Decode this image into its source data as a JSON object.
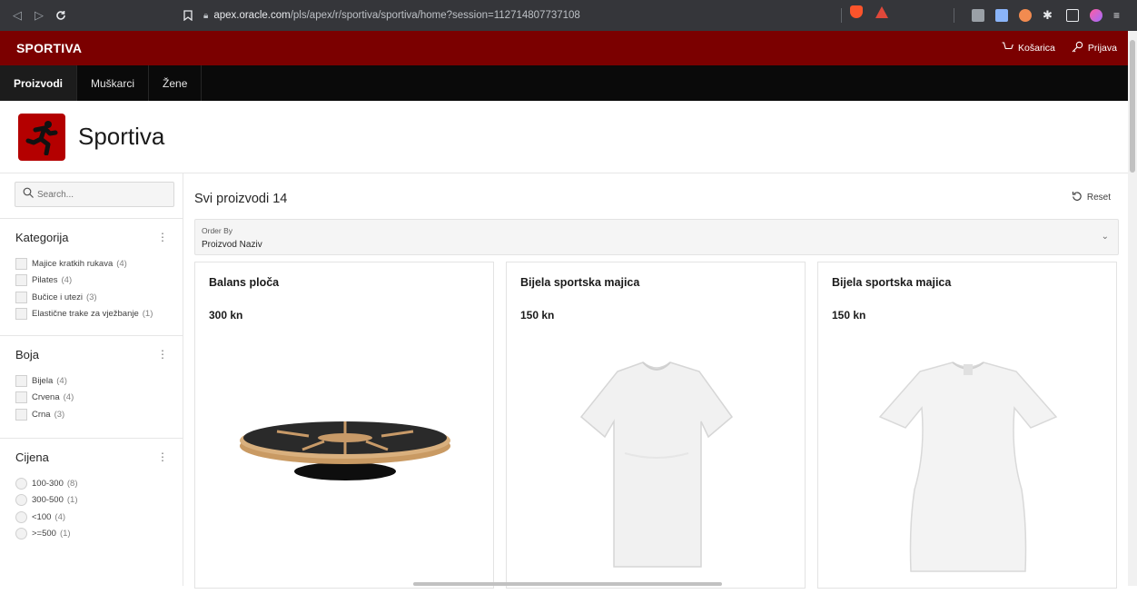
{
  "browser": {
    "url_host": "apex.oracle.com",
    "url_path": "/pls/apex/r/sportiva/sportiva/home?session=112714807737108"
  },
  "header": {
    "brand": "SPORTIVA",
    "cart_label": "Košarica",
    "login_label": "Prijava"
  },
  "nav": {
    "items": [
      {
        "label": "Proizvodi",
        "current": true
      },
      {
        "label": "Muškarci",
        "current": false
      },
      {
        "label": "Žene",
        "current": false
      }
    ]
  },
  "hero": {
    "title": "Sportiva"
  },
  "sidebar": {
    "search_placeholder": "Search...",
    "facets": [
      {
        "title": "Kategorija",
        "type": "checkbox",
        "options": [
          {
            "label": "Majice kratkih rukava",
            "count": "(4)"
          },
          {
            "label": "Pilates",
            "count": "(4)"
          },
          {
            "label": "Bučice i utezi",
            "count": "(3)"
          },
          {
            "label": "Elastične trake za vježbanje",
            "count": "(1)"
          }
        ]
      },
      {
        "title": "Boja",
        "type": "checkbox",
        "options": [
          {
            "label": "Bijela",
            "count": "(4)"
          },
          {
            "label": "Crvena",
            "count": "(4)"
          },
          {
            "label": "Crna",
            "count": "(3)"
          }
        ]
      },
      {
        "title": "Cijena",
        "type": "radio",
        "options": [
          {
            "label": "100-300",
            "count": "(8)"
          },
          {
            "label": "300-500",
            "count": "(1)"
          },
          {
            "label": "<100",
            "count": "(4)"
          },
          {
            "label": ">=500",
            "count": "(1)"
          }
        ]
      }
    ]
  },
  "results": {
    "title": "Svi proizvodi 14",
    "reset_label": "Reset",
    "order_by_label": "Order By",
    "order_by_value": "Proizvod Naziv"
  },
  "products": [
    {
      "name": "Balans ploča",
      "price": "300 kn",
      "image": "balance-board"
    },
    {
      "name": "Bijela sportska majica",
      "price": "150 kn",
      "image": "white-tshirt-men"
    },
    {
      "name": "Bijela sportska majica",
      "price": "150 kn",
      "image": "white-tshirt-women"
    }
  ],
  "colors": {
    "header_bg": "#7b0000",
    "menu_bg": "#0a0a0a",
    "logo_bg": "#b40000"
  }
}
